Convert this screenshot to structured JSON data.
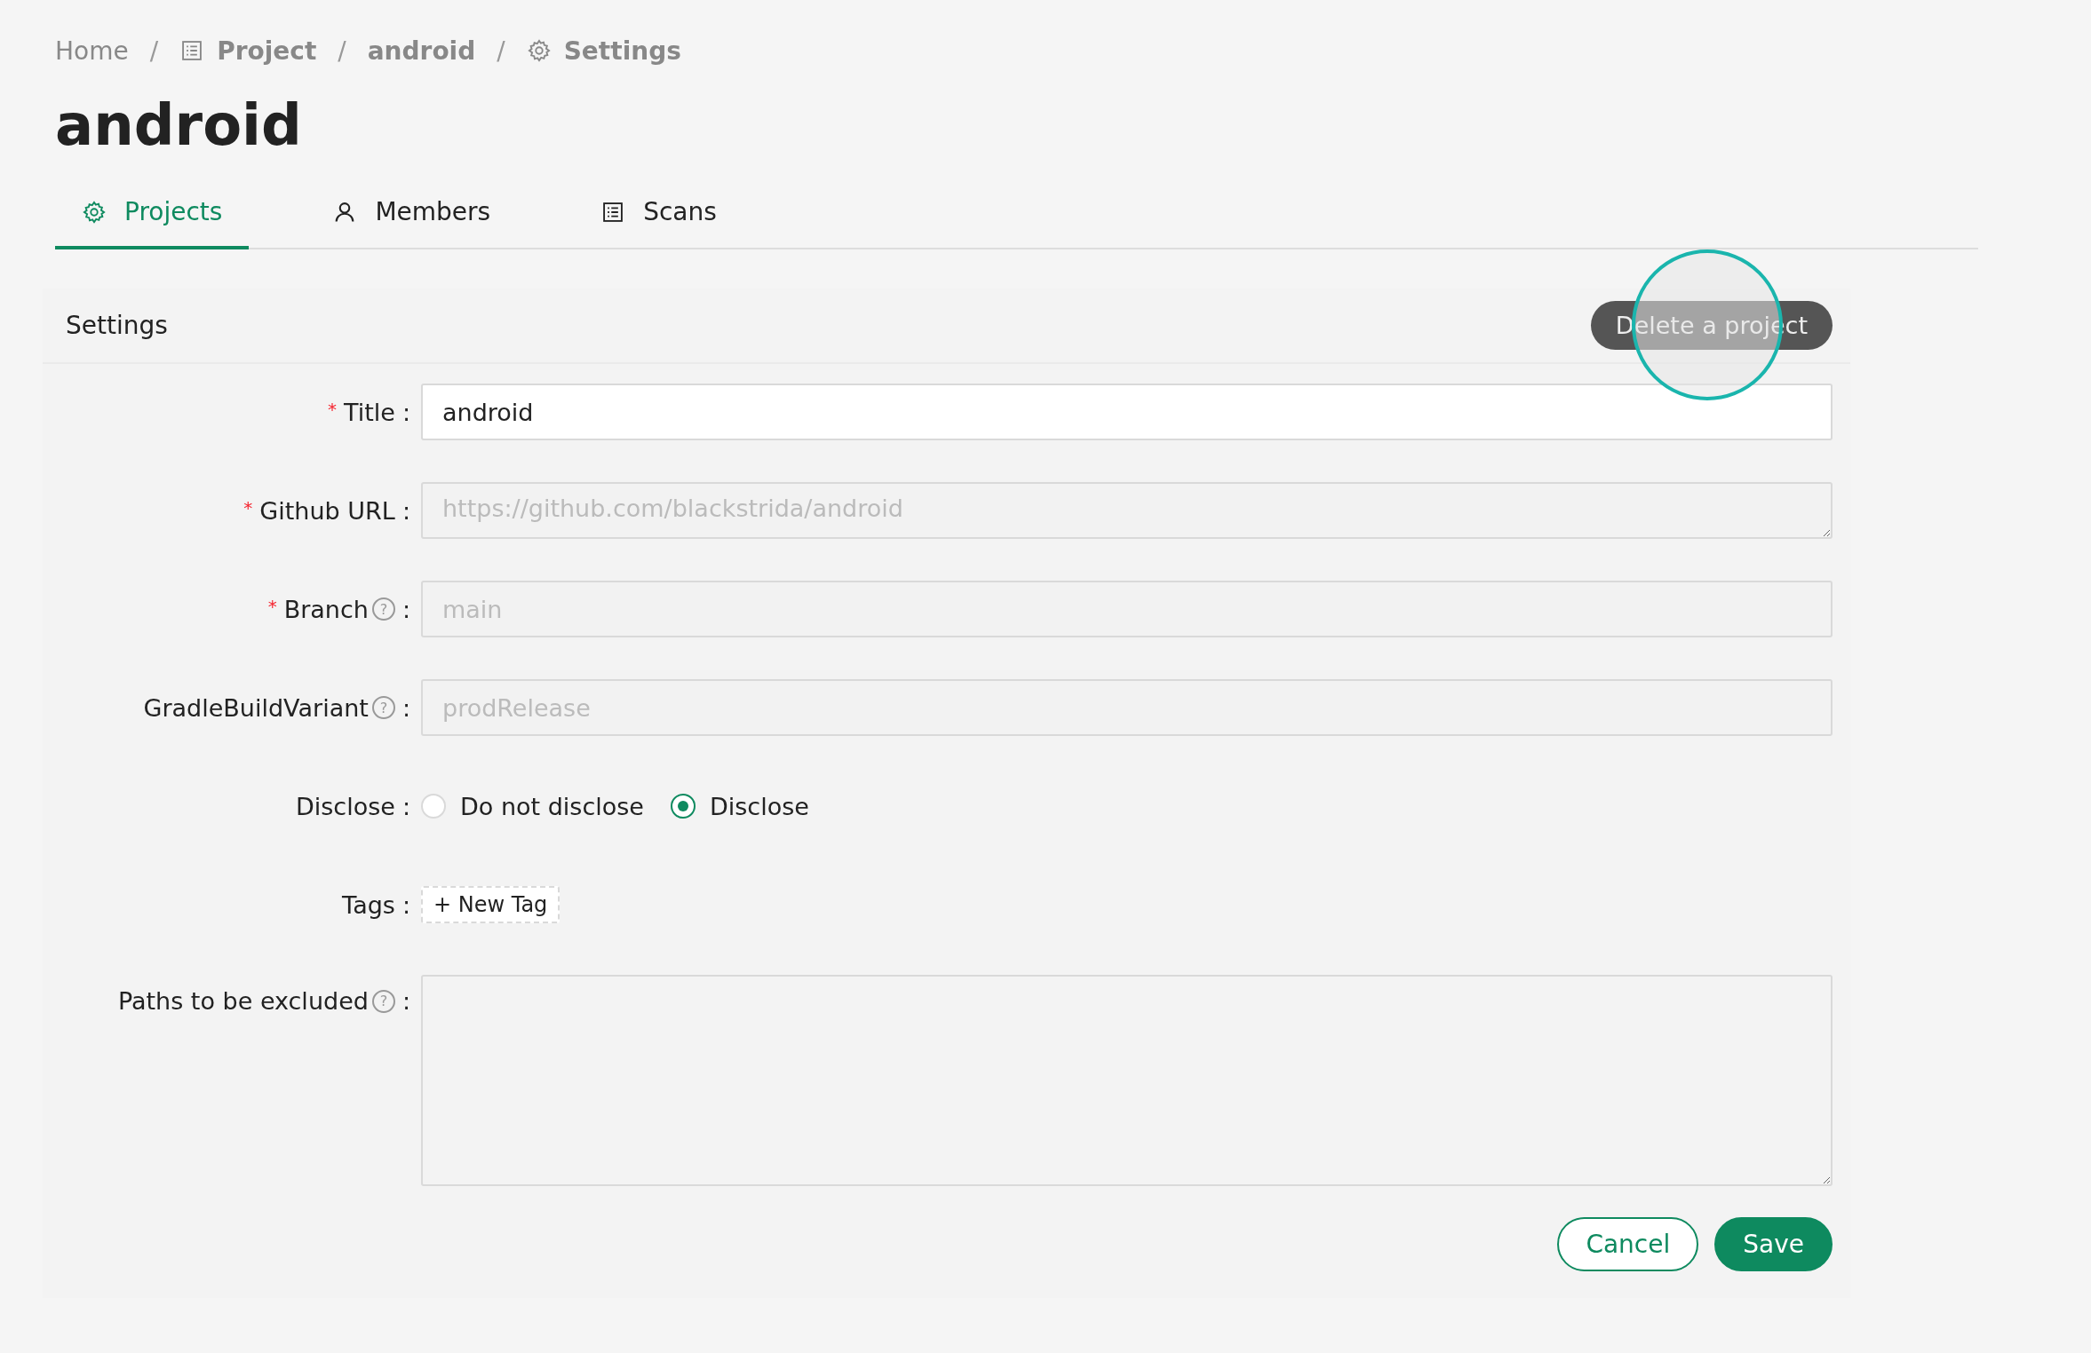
{
  "breadcrumb": [
    {
      "kind": "home",
      "label": "Home"
    },
    {
      "kind": "project",
      "label": "Project",
      "separator": "/"
    },
    {
      "kind": "item",
      "label": "android",
      "separator": "/"
    },
    {
      "kind": "settings",
      "label": "Settings",
      "separator": "/"
    }
  ],
  "page_title": "android",
  "tabs": [
    {
      "kind": "projects",
      "label": "Projects",
      "selected": true
    },
    {
      "kind": "members",
      "label": "Members",
      "selected": false
    },
    {
      "kind": "scans",
      "label": "Scans",
      "selected": false
    }
  ],
  "card": {
    "title": "Settings",
    "delete_button": "Delete a project"
  },
  "fields": [
    {
      "kind": "input",
      "required_mark": "*",
      "label": "Title",
      "colon": ":",
      "value": "android",
      "disabled": false
    },
    {
      "kind": "textarea-short",
      "required_mark": "*",
      "label": "Github URL",
      "colon": ":",
      "value": "https://github.com/blackstrida/android",
      "disabled": true
    },
    {
      "kind": "input",
      "required_mark": "*",
      "label": "Branch",
      "help_mark": "?",
      "colon": ":",
      "value": "main",
      "disabled": true
    },
    {
      "kind": "input",
      "label": "GradleBuildVariant",
      "help_mark": "?",
      "colon": ":",
      "value": "prodRelease",
      "disabled": true
    },
    {
      "kind": "radio",
      "label": "Disclose",
      "colon": ":",
      "options": [
        {
          "label": "Do not disclose",
          "selected": false
        },
        {
          "label": "Disclose",
          "selected": true
        }
      ]
    },
    {
      "kind": "tags",
      "label": "Tags",
      "colon": ":",
      "add_label": "+ New Tag"
    },
    {
      "kind": "textarea",
      "label": "Paths to be excluded",
      "help_mark": "?",
      "colon": ":"
    }
  ],
  "buttons": [
    {
      "kind": "secondary",
      "label": "Cancel"
    },
    {
      "kind": "primary",
      "label": "Save"
    }
  ]
}
